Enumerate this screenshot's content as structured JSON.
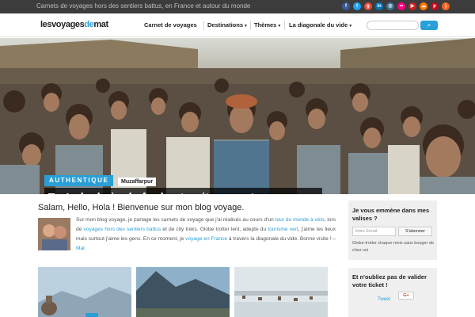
{
  "header": {
    "tagline": "Carnets de voyages hors des sentiers battus, en France et autour du monde",
    "social_icons": [
      "facebook-icon",
      "twitter-icon",
      "google-plus-icon",
      "linkedin-icon",
      "instagram-icon",
      "flickr-icon",
      "youtube-icon",
      "soundcloud-icon",
      "pinterest-icon",
      "rss-icon"
    ]
  },
  "nav": {
    "logo_part1": "lesvoyages",
    "logo_part2": "de",
    "logo_part3": "mat",
    "items": [
      {
        "label": "Carnet de voyages"
      },
      {
        "label": "Destinations"
      },
      {
        "label": "Thèmes"
      },
      {
        "label": "La diagonale du vide"
      }
    ],
    "search_icon": "search-icon"
  },
  "hero": {
    "category": "AUTHENTIQUE",
    "place": "Muzaffarpur",
    "title": "En Inde, bain de foule et nuit au poste"
  },
  "intro": {
    "heading": "Salam, Hello, Hola ! Bienvenue sur mon blog voyage.",
    "t1": "Sur mon blog voyage, je partage les carnets de voyage que j'ai réalisés au cours d'un ",
    "l1": "tour du monde à vélo",
    "t2": ", lors de ",
    "l2": "voyages hors des sentiers battus",
    "t3": " et de city treks. Globe trotter lent, adepte du ",
    "l3": "tourisme vert",
    "t4": ", j'aime les lieux mais surtout j'aime les gens. En ce moment, je ",
    "l4": "voyage en France",
    "t5": " à travers la diagonale du vide. Bonne visite ! – ",
    "l5": "Mat"
  },
  "sidebar": {
    "newsletter_title": "Je vous emmène dans mes valises ?",
    "email_placeholder": "Votre Email",
    "subscribe_label": "S'abonner",
    "newsletter_text": "Globe-trotter chaque mois sans bouger de chez soi",
    "share_title": "Et n'oubliez pas de valider votre ticket !",
    "tweet_label": "Tweet",
    "gplus_label": "G+"
  },
  "colors": {
    "accent": "#2a9fd6",
    "topbar": "#3c3c3c"
  }
}
